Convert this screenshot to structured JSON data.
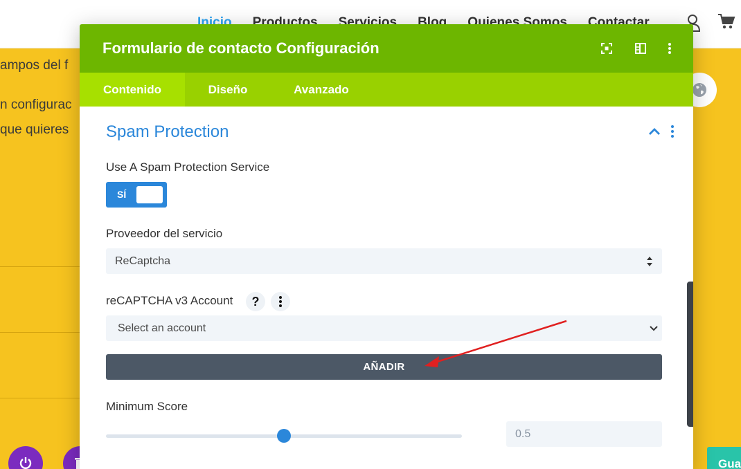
{
  "site": {
    "nav": [
      "Inicio",
      "Productos",
      "Servicios",
      "Blog",
      "Quienes Somos",
      "Contactar"
    ],
    "bg_lines": [
      "ampos del f",
      "n configurac",
      "que quieres"
    ],
    "save_label": "Gua",
    "icons": [
      "user-icon",
      "cart-icon",
      "globe-icon",
      "power-icon",
      "trash-icon"
    ]
  },
  "modal": {
    "title": "Formulario de contacto Configuración",
    "header_icons": [
      "fullscreen-icon",
      "sidebar-icon",
      "more-vertical-icon"
    ],
    "tabs": [
      "Contenido",
      "Diseño",
      "Avanzado"
    ],
    "active_tab": "Contenido",
    "section": {
      "title": "Spam Protection",
      "spam_label": "Use A Spam Protection Service",
      "toggle_label": "SÍ",
      "toggle_on": true,
      "provider_label": "Proveedor del servicio",
      "provider_value": "ReCaptcha",
      "account_label": "reCAPTCHA v3 Account",
      "help_symbol": "?",
      "account_placeholder": "Select an account",
      "add_button": "AÑADIR",
      "score_label": "Minimum Score",
      "score_value": "0.5",
      "score_fraction": 0.5
    }
  },
  "colors": {
    "header_green": "#6db600",
    "tab_green": "#99d100",
    "accent_blue": "#2b87da",
    "button_dark": "#4c5866",
    "annotation_red": "#e02020",
    "site_yellow": "#f6c31f"
  }
}
